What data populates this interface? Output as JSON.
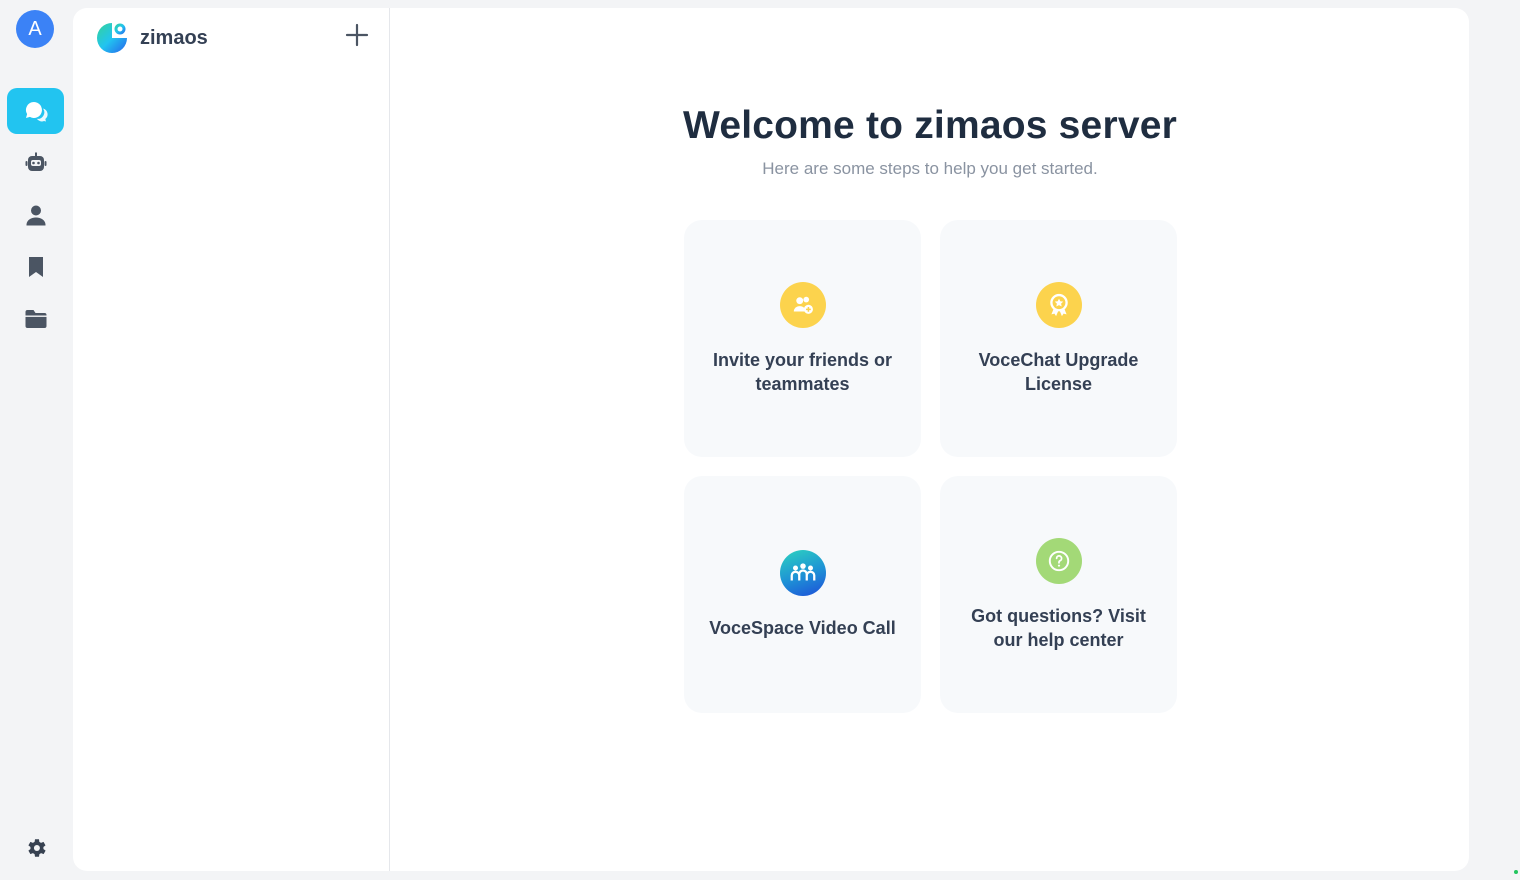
{
  "user": {
    "avatar_initial": "A",
    "avatar_color": "#3b82f6"
  },
  "rail": {
    "items": [
      {
        "name": "chat",
        "icon": "chat-bubbles-icon",
        "active": true
      },
      {
        "name": "bots",
        "icon": "robot-icon",
        "active": false
      },
      {
        "name": "users",
        "icon": "user-icon",
        "active": false
      },
      {
        "name": "saved",
        "icon": "bookmark-icon",
        "active": false
      },
      {
        "name": "files",
        "icon": "folder-icon",
        "active": false
      }
    ],
    "settings_icon": "gear-icon",
    "accent_color": "#22c4f0"
  },
  "server": {
    "name": "zimaos",
    "logo_icon": "server-logo-icon",
    "add_icon": "plus-icon"
  },
  "welcome": {
    "title": "Welcome to zimaos server",
    "subtitle": "Here are some steps to help you get started."
  },
  "cards": [
    {
      "label": "Invite your friends or teammates",
      "icon": "invite-users-icon",
      "color": "#fcd34d"
    },
    {
      "label": "VoceChat Upgrade License",
      "icon": "license-badge-icon",
      "color": "#fcd34d"
    },
    {
      "label": "VoceSpace Video Call",
      "icon": "vocespace-icon",
      "color": "#1e90d6"
    },
    {
      "label": "Got questions? Visit our help center",
      "icon": "question-icon",
      "color": "#a3d977"
    }
  ]
}
